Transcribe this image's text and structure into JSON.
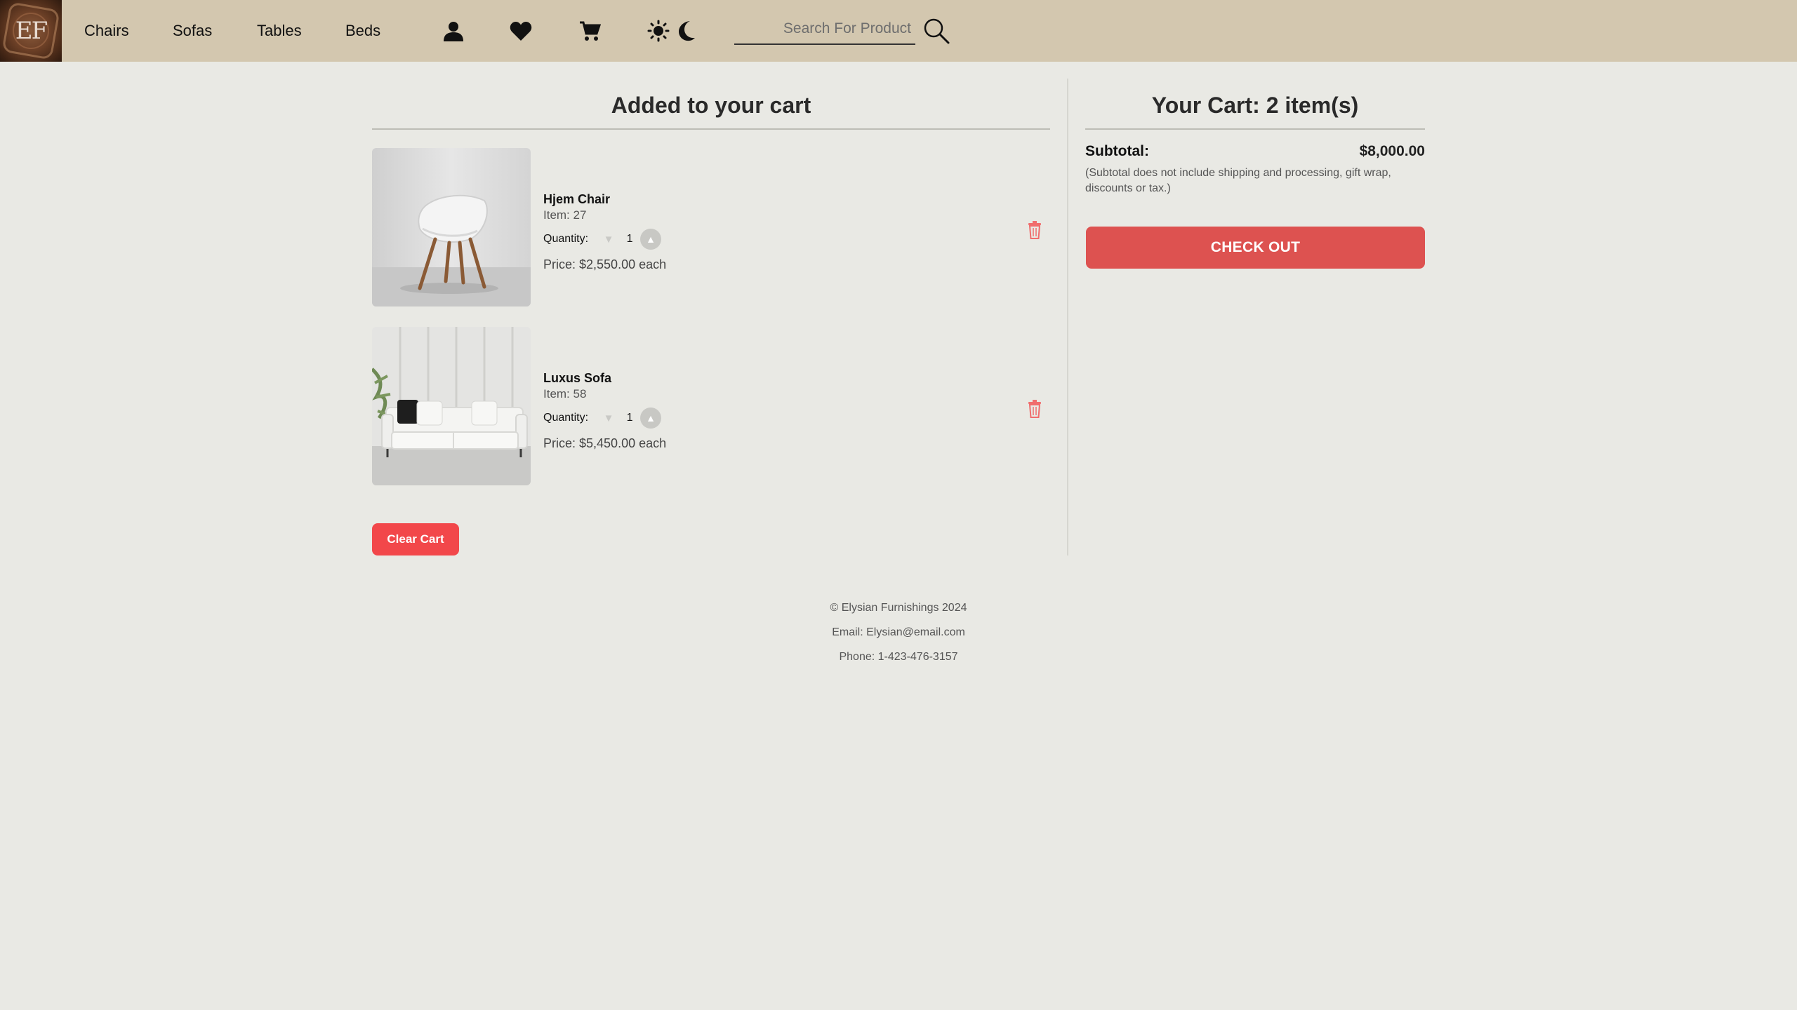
{
  "header": {
    "logo_text": "EF",
    "nav": [
      {
        "label": "Chairs"
      },
      {
        "label": "Sofas"
      },
      {
        "label": "Tables"
      },
      {
        "label": "Beds"
      }
    ],
    "icons": [
      "user-icon",
      "heart-icon",
      "cart-icon",
      "sun-icon",
      "moon-icon",
      "search-icon"
    ],
    "search": {
      "placeholder": "Search For Product",
      "value": ""
    }
  },
  "cart": {
    "title": "Added to your cart",
    "quantity_label": "Quantity:",
    "items": [
      {
        "name": "Hjem Chair",
        "item_no": "Item: 27",
        "quantity": "1",
        "price": "Price: $2,550.00 each"
      },
      {
        "name": "Luxus Sofa",
        "item_no": "Item: 58",
        "quantity": "1",
        "price": "Price: $5,450.00 each"
      }
    ],
    "clear_label": "Clear Cart"
  },
  "summary": {
    "title": "Your Cart: 2 item(s)",
    "subtotal_label": "Subtotal:",
    "subtotal_value": "$8,000.00",
    "note": "(Subtotal does not include shipping and processing, gift wrap, discounts or tax.)",
    "checkout_label": "CHECK OUT"
  },
  "footer": {
    "copyright": "© Elysian Furnishings 2024",
    "email": "Email: Elysian@email.com",
    "phone": "Phone: 1-423-476-3157"
  },
  "colors": {
    "header_bg": "#d3c7af",
    "page_bg": "#e9e9e4",
    "checkout": "#dd5250",
    "clear": "#f2474a",
    "trash": "#f06d6d"
  }
}
